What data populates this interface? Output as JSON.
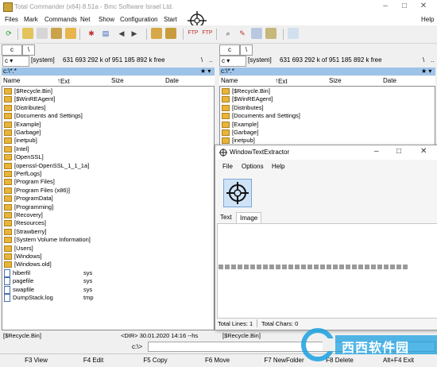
{
  "window": {
    "title": "Total Commander (x64) 8.51a - Bmc Software Israel Ltd."
  },
  "menu": [
    "Files",
    "Mark",
    "Commands",
    "Net",
    "Show",
    "Configuration",
    "Start",
    "Help"
  ],
  "left_panel": {
    "drive": "c",
    "drive_combo": "c",
    "label": "[system]",
    "free": "631 693 292 k of 951 185 892 k free",
    "path": "c:\\*.*",
    "columns": {
      "name": "Name",
      "ext": "Ext",
      "size": "Size",
      "date": "Date"
    },
    "items": [
      {
        "name": "[$Recycle.Bin]",
        "ext": ""
      },
      {
        "name": "[$WinREAgent]",
        "ext": ""
      },
      {
        "name": "[Distributes]",
        "ext": ""
      },
      {
        "name": "[Documents and Settings]",
        "ext": ""
      },
      {
        "name": "[Example]",
        "ext": ""
      },
      {
        "name": "[Garbage]",
        "ext": ""
      },
      {
        "name": "[inetpub]",
        "ext": ""
      },
      {
        "name": "[Intel]",
        "ext": ""
      },
      {
        "name": "[OpenSSL]",
        "ext": ""
      },
      {
        "name": "[openssl-OpenSSL_1_1_1a]",
        "ext": ""
      },
      {
        "name": "[PerfLogs]",
        "ext": ""
      },
      {
        "name": "[Program Files]",
        "ext": ""
      },
      {
        "name": "[Program Files (x86)]",
        "ext": ""
      },
      {
        "name": "[ProgramData]",
        "ext": ""
      },
      {
        "name": "[Programming]",
        "ext": ""
      },
      {
        "name": "[Recovery]",
        "ext": ""
      },
      {
        "name": "[Resources]",
        "ext": ""
      },
      {
        "name": "[Strawberry]",
        "ext": ""
      },
      {
        "name": "[System Volume Information]",
        "ext": ""
      },
      {
        "name": "[Users]",
        "ext": ""
      },
      {
        "name": "[Windows]",
        "ext": ""
      },
      {
        "name": "[Windows.old]",
        "ext": ""
      },
      {
        "name": "hiberfil",
        "ext": "sys"
      },
      {
        "name": "pagefile",
        "ext": "sys"
      },
      {
        "name": "swapfile",
        "ext": "sys"
      },
      {
        "name": "DumpStack.log",
        "ext": "tmp"
      }
    ]
  },
  "right_panel": {
    "drive": "c",
    "drive_combo": "c",
    "label": "[system]",
    "free": "631 693 292 k of 951 185 892 k free",
    "path": "c:\\*.*",
    "columns": {
      "name": "Name",
      "ext": "Ext",
      "size": "Size",
      "date": "Date"
    },
    "items": [
      "[$Recycle.Bin]",
      "[$WinREAgent]",
      "[Distributes]",
      "[Documents and Settings]",
      "[Example]",
      "[Garbage]",
      "[inetpub]"
    ]
  },
  "status": {
    "left_name": "[$Recycle.Bin]",
    "left_info": "<DIR>   30.01.2020 14:16 --hs",
    "right_name": "[$Recycle.Bin]",
    "cmd_prompt": "c:\\>"
  },
  "fkeys": [
    "F3 View",
    "F4 Edit",
    "F5 Copy",
    "F6 Move",
    "F7 NewFolder",
    "F8 Delete",
    "Alt+F4 Exit"
  ],
  "wte": {
    "title": "WindowTextExtractor",
    "menu": [
      "File",
      "Options",
      "Help"
    ],
    "tabs": [
      "Text",
      "Image"
    ],
    "status_lines": "Total Lines: 1",
    "status_chars": "Total Chars: 0"
  },
  "watermark": {
    "text": "西西软件园"
  }
}
